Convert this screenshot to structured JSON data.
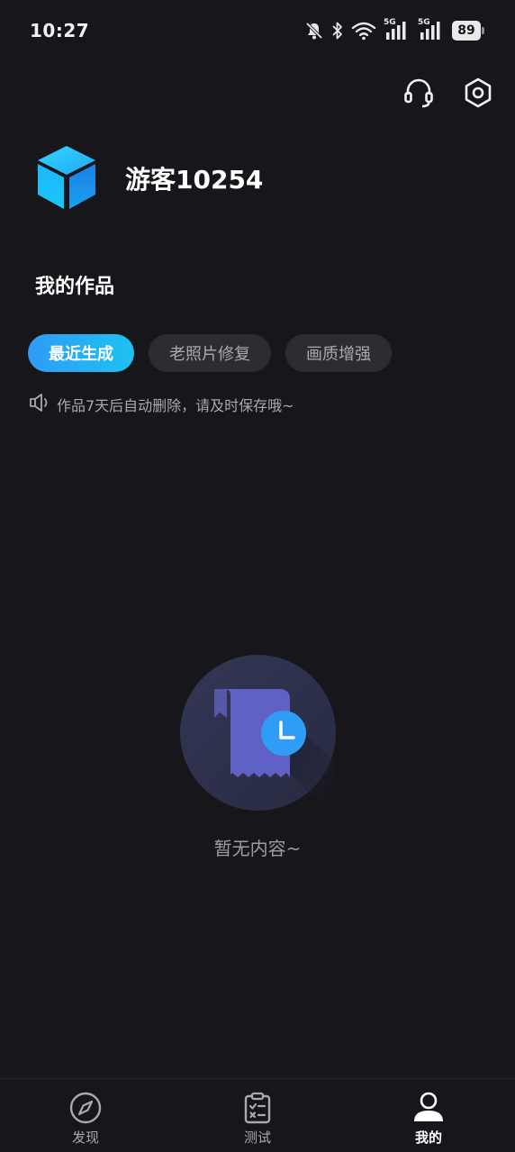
{
  "status_bar": {
    "time": "10:27",
    "battery": "89",
    "signal_labels": [
      "5G",
      "5G"
    ]
  },
  "header": {
    "support_icon": "headset-icon",
    "settings_icon": "hexagon-gear-icon"
  },
  "profile": {
    "username": "游客10254",
    "avatar_icon": "cube-icon"
  },
  "works": {
    "title": "我的作品",
    "tabs": [
      {
        "label": "最近生成",
        "active": true
      },
      {
        "label": "老照片修复",
        "active": false
      },
      {
        "label": "画质增强",
        "active": false
      }
    ],
    "notice": "作品7天后自动删除，请及时保存哦~",
    "notice_icon": "speaker-icon",
    "empty_text": "暂无内容~",
    "empty_icon": "document-clock-icon"
  },
  "bottom_nav": [
    {
      "label": "发现",
      "icon": "compass-icon",
      "active": false
    },
    {
      "label": "测试",
      "icon": "clipboard-icon",
      "active": false
    },
    {
      "label": "我的",
      "icon": "user-icon",
      "active": true
    }
  ],
  "colors": {
    "background": "#16161b",
    "accent_start": "#2f9cf5",
    "accent_end": "#1ec2f2",
    "tab_inactive": "#2c2c32",
    "muted_text": "#a9a9b0"
  }
}
